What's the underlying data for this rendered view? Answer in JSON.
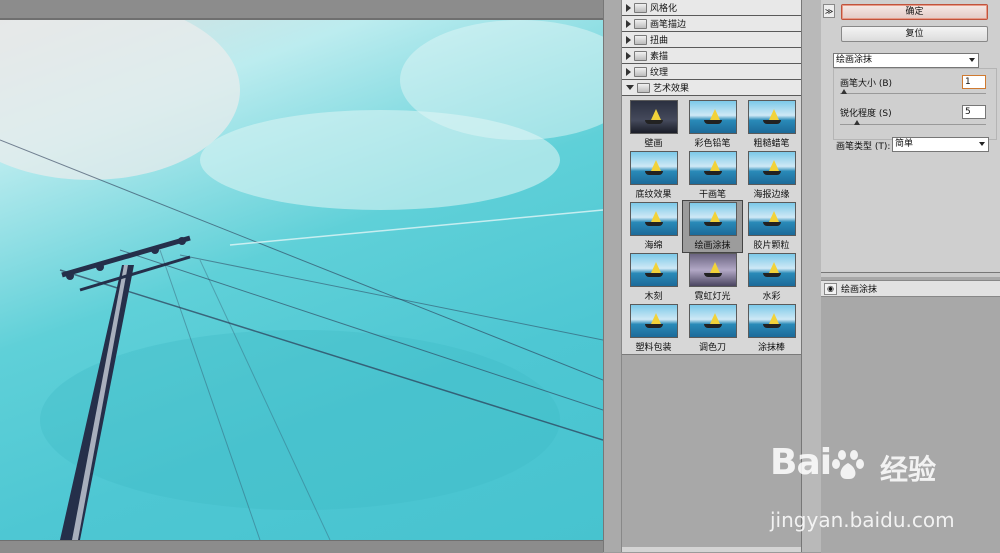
{
  "filter_gallery": {
    "categories": [
      {
        "label": "风格化",
        "expanded": false
      },
      {
        "label": "画笔描边",
        "expanded": false
      },
      {
        "label": "扭曲",
        "expanded": false
      },
      {
        "label": "素描",
        "expanded": false
      },
      {
        "label": "纹理",
        "expanded": false
      },
      {
        "label": "艺术效果",
        "expanded": true
      }
    ],
    "effects": [
      "壁画",
      "彩色铅笔",
      "粗糙蜡笔",
      "底纹效果",
      "干画笔",
      "海报边缘",
      "海绵",
      "绘画涂抹",
      "胶片颗粒",
      "木刻",
      "霓虹灯光",
      "水彩",
      "塑料包装",
      "调色刀",
      "涂抹棒"
    ],
    "selected_effect": "绘画涂抹"
  },
  "buttons": {
    "ok": "确定",
    "reset": "复位",
    "collapse": "≫"
  },
  "settings": {
    "filter_select": "绘画涂抹",
    "brush_size_label": "画笔大小 (B)",
    "brush_size_value": "1",
    "sharpness_label": "锐化程度 (S)",
    "sharpness_value": "5",
    "brush_type_label": "画笔类型 (T):",
    "brush_type_value": "简单"
  },
  "layers": {
    "items": [
      {
        "label": "绘画涂抹",
        "visible": true
      }
    ]
  },
  "watermark": {
    "brand": "Bai",
    "brand_cn": "经验",
    "url": "jingyan.baidu.com"
  },
  "colors": {
    "preview_sky": "#4ec7d3",
    "accent_ok": "#c0533c",
    "panel_bg": "#d4d4d4"
  }
}
